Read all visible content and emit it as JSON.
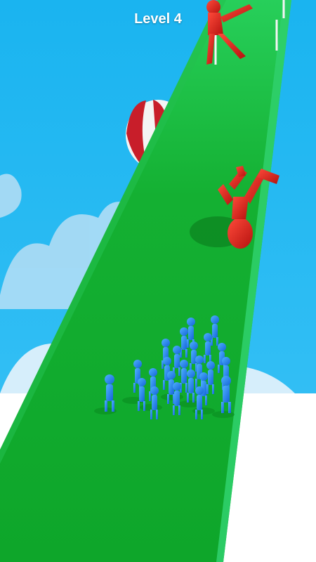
{
  "hud": {
    "level_label": "Level 4"
  },
  "colors": {
    "sky": "#1fb6ef",
    "track": "#11a828",
    "track_edge": "#32c65a",
    "player_crowd": "#1e86f2",
    "enemy": "#e3221f",
    "balloon_red": "#c81e2a",
    "balloon_white": "#f4f4f4"
  },
  "scene": {
    "player_crowd_count": 24,
    "enemy_count": 2
  }
}
